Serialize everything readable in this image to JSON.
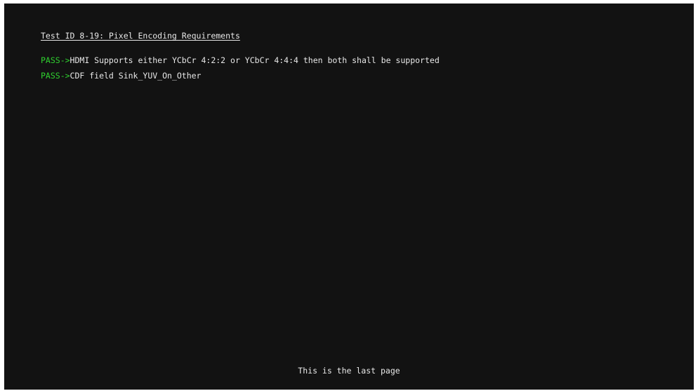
{
  "screen": {
    "title": "Test ID 8-19: Pixel Encoding Requirements",
    "results": [
      {
        "status": "PASS->",
        "text": "HDMI Supports either YCbCr 4:2:2 or YCbCr 4:4:4 then both shall be supported"
      },
      {
        "status": "PASS->",
        "text": "CDF field Sink_YUV_On_Other"
      }
    ],
    "footer": "This is the last page"
  },
  "colors": {
    "background": "#121212",
    "text": "#e8e8e8",
    "pass": "#2fd12f"
  }
}
